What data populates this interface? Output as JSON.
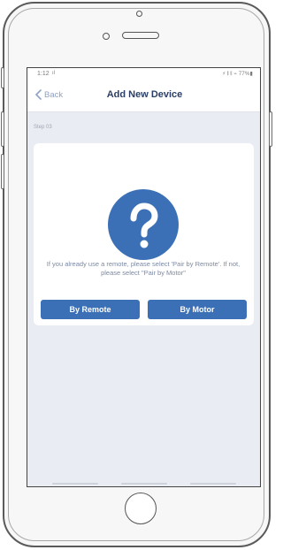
{
  "status_bar": {
    "time": "1:12",
    "signal_glyph": "ıl",
    "right_indicators": "⚡ 𝄃 𝄃 ⌁ 77%▮"
  },
  "nav": {
    "back_label": "Back",
    "title": "Add New Device"
  },
  "step_label": "Step 03",
  "card": {
    "message": "If you already use a remote, please select 'Pair by Remote'. If not, please select \"Pair by Motor\"",
    "buttons": {
      "remote_label": "By Remote",
      "motor_label": "By Motor"
    }
  },
  "colors": {
    "accent_blue": "#3b6fb6",
    "title_navy": "#2a3e66",
    "back_link": "#8fa3c6",
    "screen_bg": "#e9ecf2"
  },
  "icons": {
    "back": "chevron-left-icon",
    "question": "question-mark-icon"
  }
}
